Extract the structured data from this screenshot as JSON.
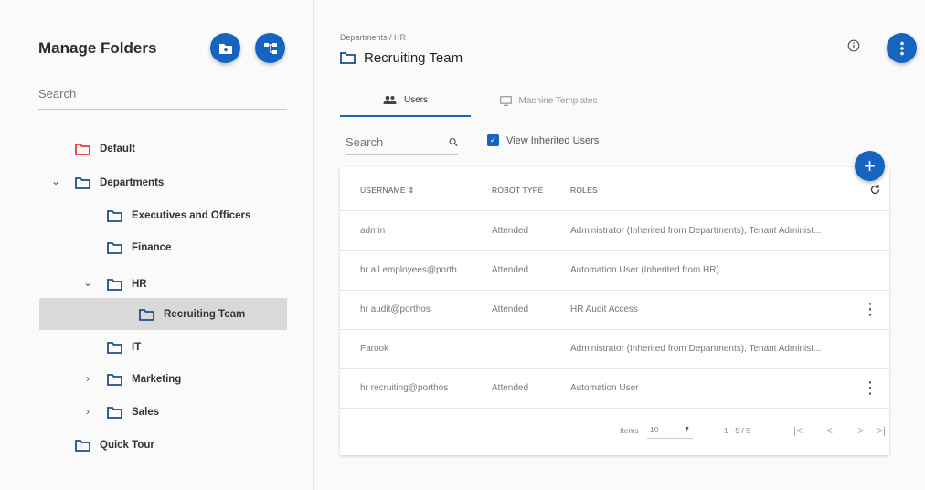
{
  "sidebar": {
    "title": "Manage Folders",
    "search_placeholder": "Search",
    "tree": [
      {
        "label": "Default",
        "color": "#e53935"
      },
      {
        "label": "Departments",
        "color": "#1e4e8c",
        "chevron": "⌄"
      },
      {
        "label": "Executives and Officers",
        "color": "#1e4e8c"
      },
      {
        "label": "Finance",
        "color": "#1e4e8c"
      },
      {
        "label": "HR",
        "color": "#1e4e8c",
        "chevron": "⌄"
      },
      {
        "label": "Recruiting Team",
        "color": "#1e4e8c"
      },
      {
        "label": "IT",
        "color": "#1e4e8c"
      },
      {
        "label": "Marketing",
        "color": "#1e4e8c",
        "chevron": "›"
      },
      {
        "label": "Sales",
        "color": "#1e4e8c",
        "chevron": "›"
      },
      {
        "label": "Quick Tour",
        "color": "#1e4e8c"
      }
    ]
  },
  "header": {
    "breadcrumb": "Departments / HR",
    "title": "Recruiting Team"
  },
  "tabs": [
    {
      "label": "Users",
      "icon": "users-icon"
    },
    {
      "label": "Machine Templates",
      "icon": "monitor-icon"
    }
  ],
  "toolbar": {
    "search_placeholder": "Search",
    "view_inherited_label": "View Inherited Users"
  },
  "table": {
    "columns": [
      "USERNAME ⇕",
      "ROBOT TYPE",
      "ROLES"
    ],
    "rows": [
      {
        "username": "admin",
        "robot_type": "Attended",
        "roles": "Administrator (Inherited from Departments), Tenant Administ..."
      },
      {
        "username": "hr all employees@porth...",
        "robot_type": "Attended",
        "roles": "Automation User (Inherited from HR)"
      },
      {
        "username": "hr audit@porthos",
        "robot_type": "Attended",
        "roles": "HR Audit Access"
      },
      {
        "username": "Farook",
        "robot_type": "",
        "roles": "Administrator (Inherited from Departments), Tenant Administ..."
      },
      {
        "username": "hr recruiting@porthos",
        "robot_type": "Attended",
        "roles": "Automation User"
      }
    ]
  },
  "pagination": {
    "items_label": "Items",
    "page_size": "10",
    "range": "1 - 5 / 5"
  },
  "colors": {
    "accent": "#1565c0",
    "selected_row": "#d9d9d9",
    "default_folder": "#e53935",
    "folder": "#1e4e8c"
  }
}
